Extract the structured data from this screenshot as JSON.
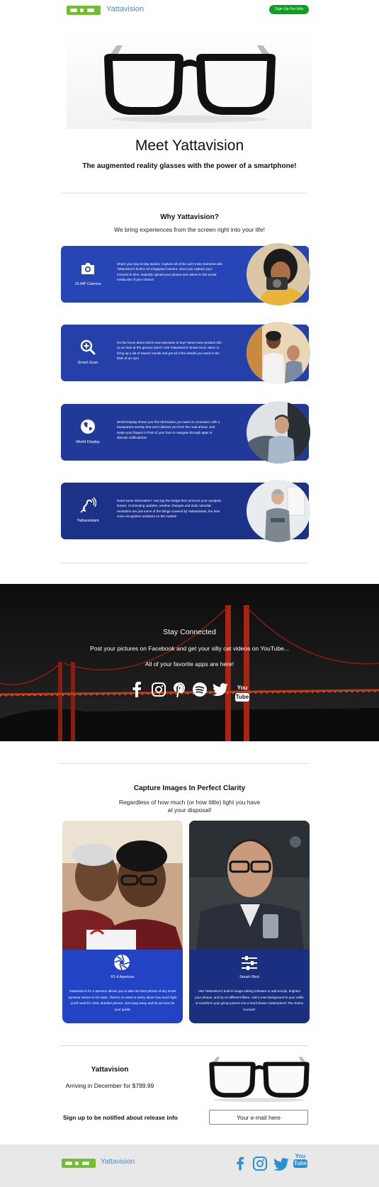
{
  "header": {
    "brand": "Yattavision",
    "signup_button": "Sign Up For Info"
  },
  "hero": {
    "title": "Meet Yattavision",
    "subtitle": "The augmented reality glasses with the power of a smartphone!"
  },
  "why": {
    "title": "Why Yattavision?",
    "subtitle": "We bring experiences from the screen right into your life!",
    "features": [
      {
        "label": "15 MP Camera",
        "icon": "camera-icon",
        "color": "#2745b4",
        "text": "Share your day-to-day stories. Capture all of the can't miss moments with Yattavision's built-in 15 megapixel camera. Once you capture your moment in time, instantly upload your photos and videos to the social media site of your choice!"
      },
      {
        "label": "Smart-Scan",
        "icon": "magnifier-plus-icon",
        "color": "#2540a8",
        "text": "On the fence about which new television to buy? Need more product info on an item at the grocery store? Use Yattavision's Smart-Scan vision to bring up a list of search results and get all of the details you need in the blink of an eye!"
      },
      {
        "label": "World Display",
        "icon": "globe-icon",
        "color": "#213a9a",
        "text": "World-Display shows you the information you want on command, with a transparent overlay that won't distract you from the road ahead. Just swipe your fingers in front of your face to navigate through apps or dismiss notifications!"
      },
      {
        "label": "Yattassistant",
        "icon": "hearing-icon",
        "color": "#1c3289",
        "text": "Need some information? Just tap the bridge that connects your eyeglass lenses. Commuting updates, weather changes and daily calendar reminders are just some of the things covered by Yattassistant, the best voice recognition assistant on the market!"
      }
    ]
  },
  "connected": {
    "title": "Stay Connected",
    "line1": "Post your pictures on Facebook and get your silly cat videos on YouTube...",
    "line2": "All of your favorite apps are here!",
    "youtube_you": "You",
    "youtube_tube": "Tube"
  },
  "capture": {
    "title": "Capture Images In Perfect Clarity",
    "subtitle_1": "Regardless of how much (or how little) light you have",
    "subtitle_2": "at your disposal!",
    "cards": [
      {
        "title": "f/1.4 Aperture",
        "icon": "aperture-icon",
        "color": "#2244c4",
        "text": "Yattavision's f/1.4 aperture allows you to take the best photos of any smart eyewear device in it's class. There's no need to worry about how much light you'll need for clear, detailed photos. Just snap away and let our lens be your guide!"
      },
      {
        "title": "Smart-Shot",
        "icon": "sliders-icon",
        "color": "#1b2f80",
        "text": "Use Yattavision's built-in image editing software to add emojis, brighten your photos, and try on different filters. Add a new background to your selfie or transform your group picture into a hand-drawn masterpiece! The choice is yours!"
      }
    ]
  },
  "release": {
    "title": "Yattavision",
    "price_line": "Arriving in December for $799.99",
    "signup_text": "Sign up to be notified about release info",
    "email_placeholder": "Your e-mail here"
  },
  "footer": {
    "brand": "Yattavision",
    "youtube_you": "You",
    "youtube_tube": "Tube"
  },
  "colors": {
    "accent_green": "#0f9d22",
    "brand_blue": "#3b8fd8",
    "footer_icon_blue": "#2b8fd6"
  }
}
